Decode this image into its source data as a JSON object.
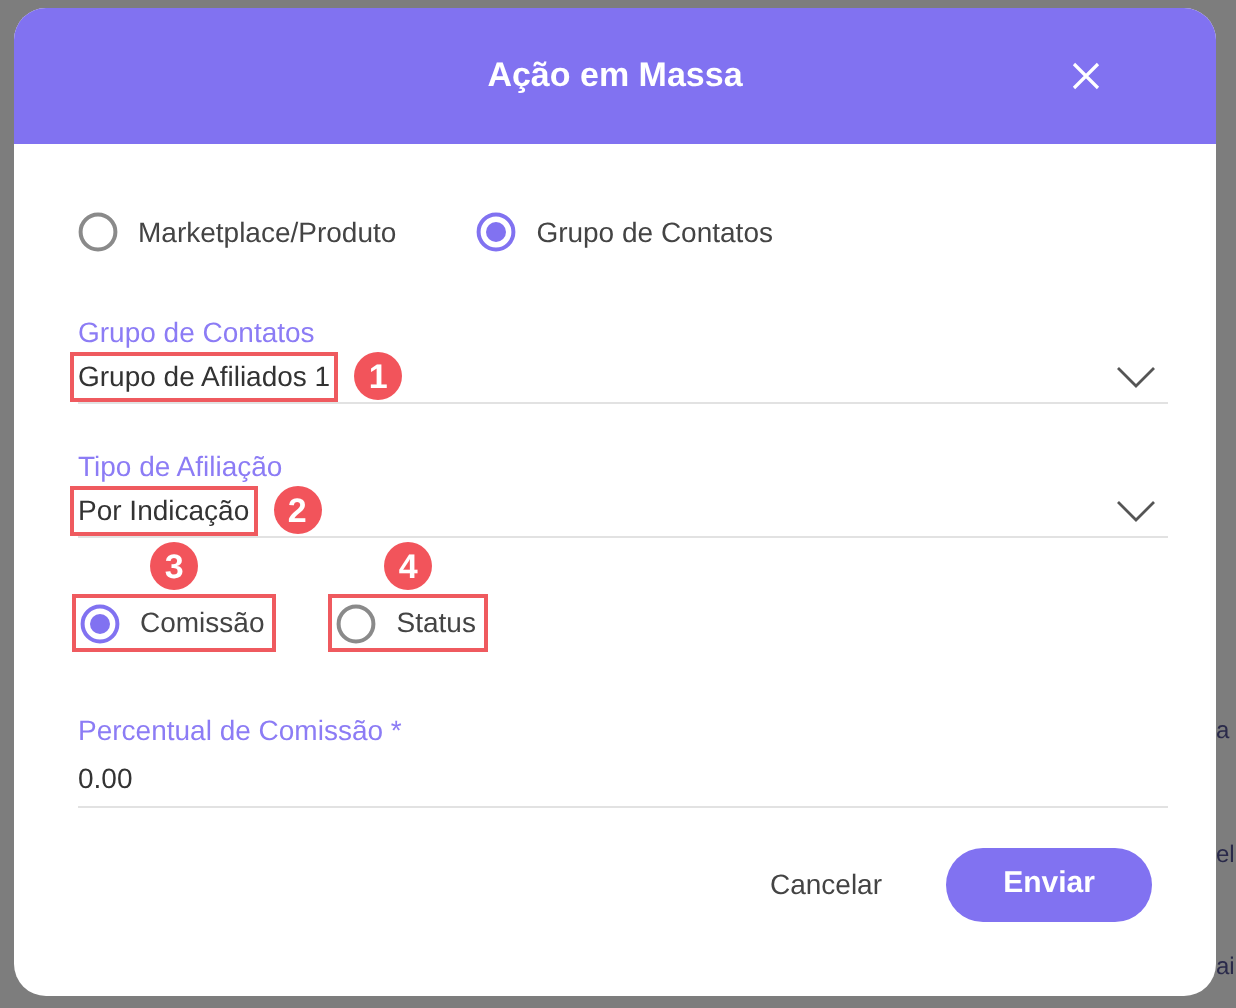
{
  "dialog": {
    "title": "Ação em Massa"
  },
  "source_options": [
    {
      "label": "Marketplace/Produto",
      "selected": false
    },
    {
      "label": "Grupo de Contatos",
      "selected": true
    }
  ],
  "fields": [
    {
      "label": "Grupo de Contatos",
      "value": "Grupo de Afiliados 1",
      "highlighted": true,
      "callout": "1"
    },
    {
      "label": "Tipo de Afiliação",
      "value": "Por Indicação",
      "highlighted": true,
      "callout": "2"
    }
  ],
  "update_options": [
    {
      "label": "Comissão",
      "selected": true,
      "highlighted": true,
      "callout": "3"
    },
    {
      "label": "Status",
      "selected": false,
      "highlighted": true,
      "callout": "4"
    }
  ],
  "commission_field": {
    "label": "Percentual de Comissão *",
    "value": "0.00"
  },
  "buttons": {
    "cancel": "Cancelar",
    "submit": "Enviar"
  },
  "background_fragments": [
    "a",
    "el",
    "ai"
  ]
}
